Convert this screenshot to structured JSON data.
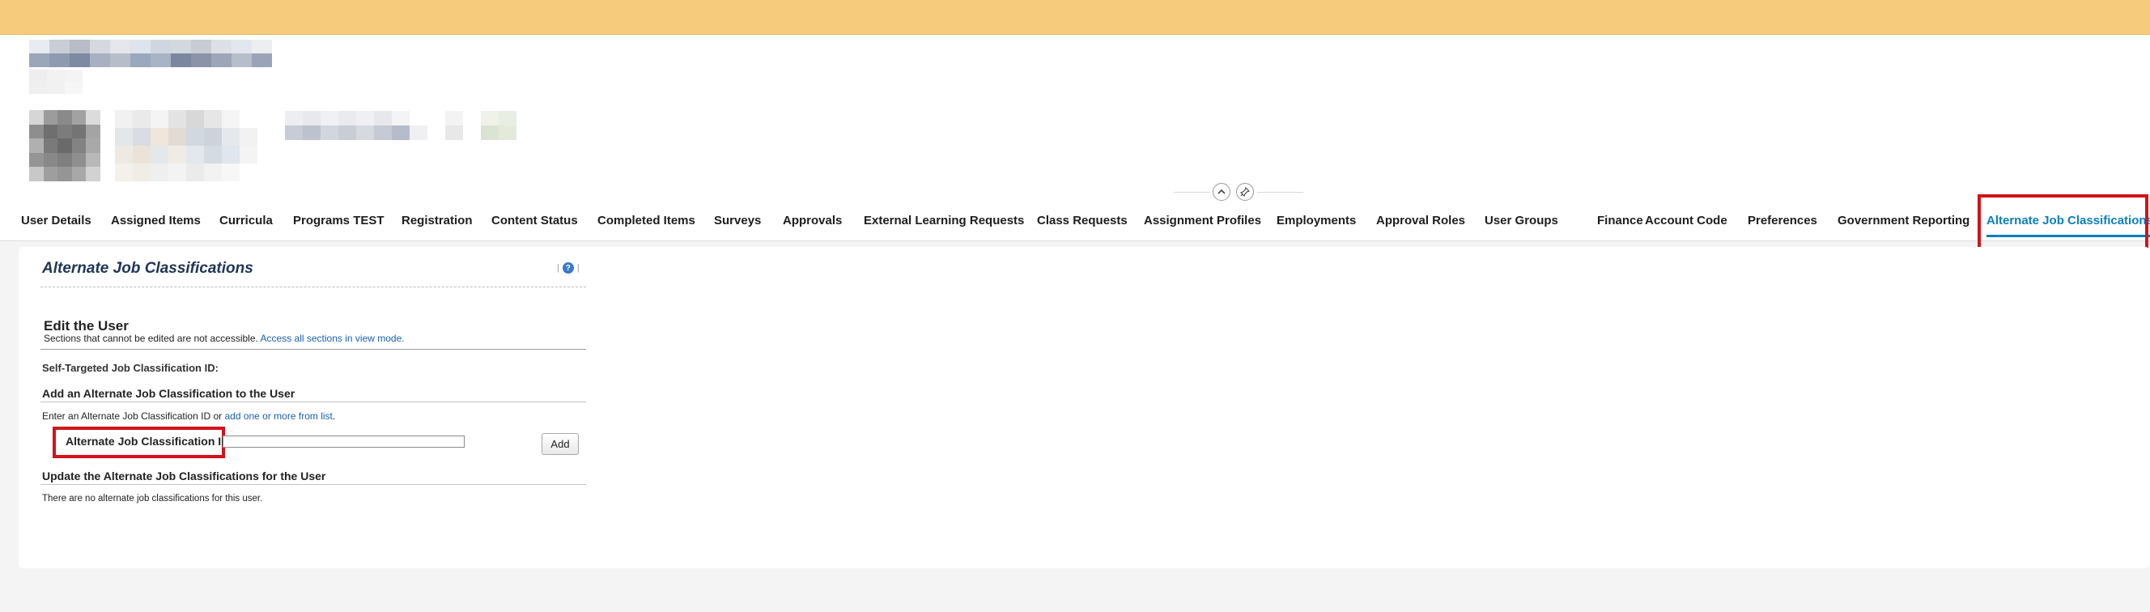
{
  "colors": {
    "banner": "#f6cb7b",
    "active_tab": "#0a7fbd",
    "highlight": "#d4121a",
    "link": "#1a5fb4",
    "title": "#1f3556"
  },
  "tabs": [
    {
      "label": "User Details",
      "name": "tab-user-details"
    },
    {
      "label": "Assigned Items",
      "name": "tab-assigned-items"
    },
    {
      "label": "Curricula",
      "name": "tab-curricula"
    },
    {
      "label": "Programs TEST",
      "name": "tab-programs-test"
    },
    {
      "label": "Registration",
      "name": "tab-registration"
    },
    {
      "label": "Content Status",
      "name": "tab-content-status"
    },
    {
      "label": "Completed Items",
      "name": "tab-completed-items"
    },
    {
      "label": "Surveys",
      "name": "tab-surveys"
    },
    {
      "label": "Approvals",
      "name": "tab-approvals"
    },
    {
      "label": "External Learning Requests",
      "name": "tab-external-learning-requests"
    },
    {
      "label": "Class Requests",
      "name": "tab-class-requests"
    },
    {
      "label": "Assignment Profiles",
      "name": "tab-assignment-profiles"
    },
    {
      "label": "Employments",
      "name": "tab-employments"
    },
    {
      "label": "Approval Roles",
      "name": "tab-approval-roles"
    },
    {
      "label": "User Groups",
      "name": "tab-user-groups"
    },
    {
      "label": "Finance",
      "name": "tab-finance"
    },
    {
      "label": "Account Code",
      "name": "tab-account-code"
    },
    {
      "label": "Preferences",
      "name": "tab-preferences"
    },
    {
      "label": "Government Reporting",
      "name": "tab-government-reporting"
    },
    {
      "label": "Alternate Job Classifications",
      "name": "tab-alternate-job-classifications",
      "active": true
    }
  ],
  "icons": {
    "collapse": "chevron-up-icon",
    "pin": "pin-icon",
    "help": "help-icon"
  },
  "section": {
    "title": "Alternate Job Classifications",
    "help_glyph": "?"
  },
  "edit": {
    "heading": "Edit the User",
    "note": "Sections that cannot be edited are not accessible.",
    "note_link": "Access all sections in view mode."
  },
  "self_targeted_label": "Self-Targeted Job Classification ID:",
  "add_section": {
    "heading": "Add an Alternate Job Classification to the User",
    "enter_text": "Enter an Alternate Job Classification ID or",
    "enter_link": "add one or more from list",
    "enter_suffix": ".",
    "field_label": "Alternate Job Classification ID",
    "field_value": "",
    "button_label": "Add"
  },
  "update_section": {
    "heading": "Update the Alternate Job Classifications for the User",
    "empty_text": "There are no alternate job classifications for this user."
  }
}
